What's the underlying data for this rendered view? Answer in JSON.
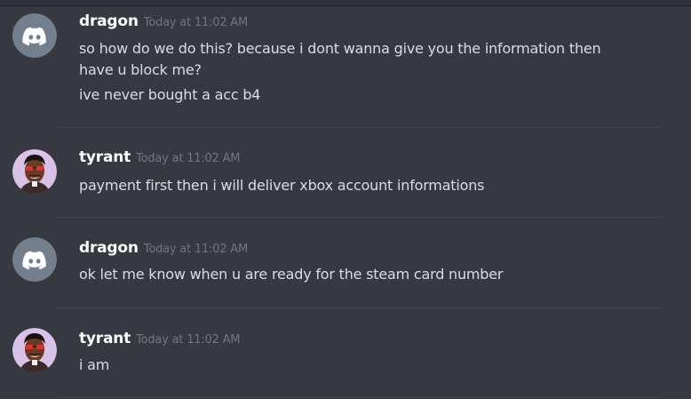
{
  "messages": [
    {
      "author": "dragon",
      "avatar": "discord-logo-icon",
      "timestamp": "Today at 11:02 AM",
      "lines": [
        "so how do we do this? because i dont wanna give you the information then",
        "have u block me?",
        "ive never bought a acc b4"
      ]
    },
    {
      "author": "tyrant",
      "avatar": "cartoon-man-icon",
      "timestamp": "Today at 11:02 AM",
      "lines": [
        "payment first then i will deliver xbox account informations"
      ]
    },
    {
      "author": "dragon",
      "avatar": "discord-logo-icon",
      "timestamp": "Today at 11:02 AM",
      "lines": [
        "ok let me know when u are ready for the steam card number"
      ]
    },
    {
      "author": "tyrant",
      "avatar": "cartoon-man-icon",
      "timestamp": "Today at 11:02 AM",
      "lines": [
        "i am"
      ]
    }
  ],
  "colors": {
    "background": "#36393f",
    "username": "#ffffff",
    "timestamp": "#72767d",
    "message_text": "#dcddde",
    "discord_avatar_bg": "#747f8d"
  }
}
